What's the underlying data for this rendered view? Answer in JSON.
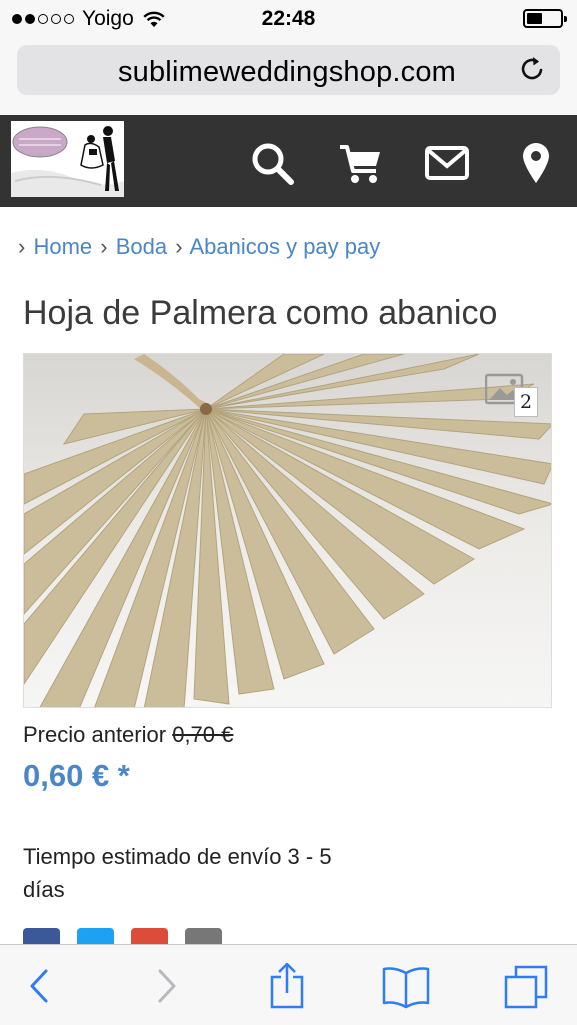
{
  "status_bar": {
    "carrier": "Yoigo",
    "time": "22:48",
    "signal_bars_filled": 2,
    "signal_bars_total": 5,
    "battery_level": 0.45
  },
  "browser": {
    "url": "sublimeweddingshop.com",
    "reload_icon": "reload-icon"
  },
  "site_header": {
    "background": "#333333",
    "icons": [
      "search-icon",
      "cart-icon",
      "mail-icon",
      "location-pin-icon"
    ]
  },
  "breadcrumb": {
    "items": [
      "Home",
      "Boda",
      "Abanicos y pay pay"
    ],
    "separator": "›"
  },
  "product": {
    "title": "Hoja de Palmera como abanico",
    "image_count": "2",
    "old_price_label": "Precio anterior",
    "old_price": "0,70 €",
    "price": "0,60 € *",
    "shipping_line1": "Tiempo estimado de envío 3 - 5",
    "shipping_line2": "días"
  },
  "share": {
    "icons": [
      "facebook-icon",
      "twitter-icon",
      "google-plus-icon",
      "email-icon"
    ],
    "colors": [
      "#3b5998",
      "#1da1f2",
      "#dd4b39",
      "#777777"
    ]
  },
  "toolbar": {
    "icons": [
      "back-icon",
      "forward-icon",
      "share-icon",
      "bookmarks-icon",
      "tabs-icon"
    ],
    "accent": "#2f7cf6"
  },
  "colors": {
    "link": "#4a86c8",
    "price": "#4a86c8"
  }
}
